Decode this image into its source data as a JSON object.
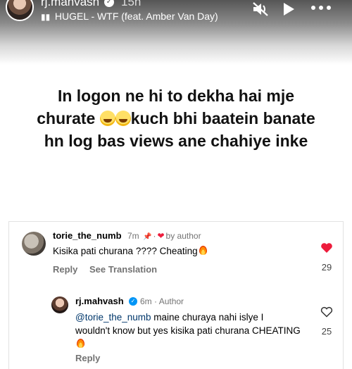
{
  "story": {
    "username": "rj.mahvash",
    "time": "15h",
    "music": "HUGEL - WTF (feat. Amber Van Day)",
    "icons": [
      "verified-badge-icon",
      "music-bars-icon",
      "mute-icon",
      "play-icon",
      "more-icon"
    ]
  },
  "post": {
    "line1": "In logon ne hi to dekha hai mje",
    "line2a": "churate",
    "line2b": "kuch bhi baatein banate",
    "line3": "hn log bas views ane chahiye inke",
    "emoji": "laughing-emoji-icon"
  },
  "comments": [
    {
      "username": "torie_the_numb",
      "time": "7m",
      "badge": "by author",
      "text": "Kisika pati churana ???? Cheating",
      "reply_label": "Reply",
      "translate_label": "See Translation",
      "likes": "29",
      "liked": true,
      "accent": "#ed1c3c"
    },
    {
      "username": "rj.mahvash",
      "time": "6m",
      "badge": "Author",
      "mention": "@torie_the_numb",
      "text": " maine churaya nahi islye I wouldn't know but yes kisika pati churana CHEATING",
      "reply_label": "Reply",
      "likes": "25",
      "liked": false,
      "accent": "#0095f6"
    }
  ]
}
